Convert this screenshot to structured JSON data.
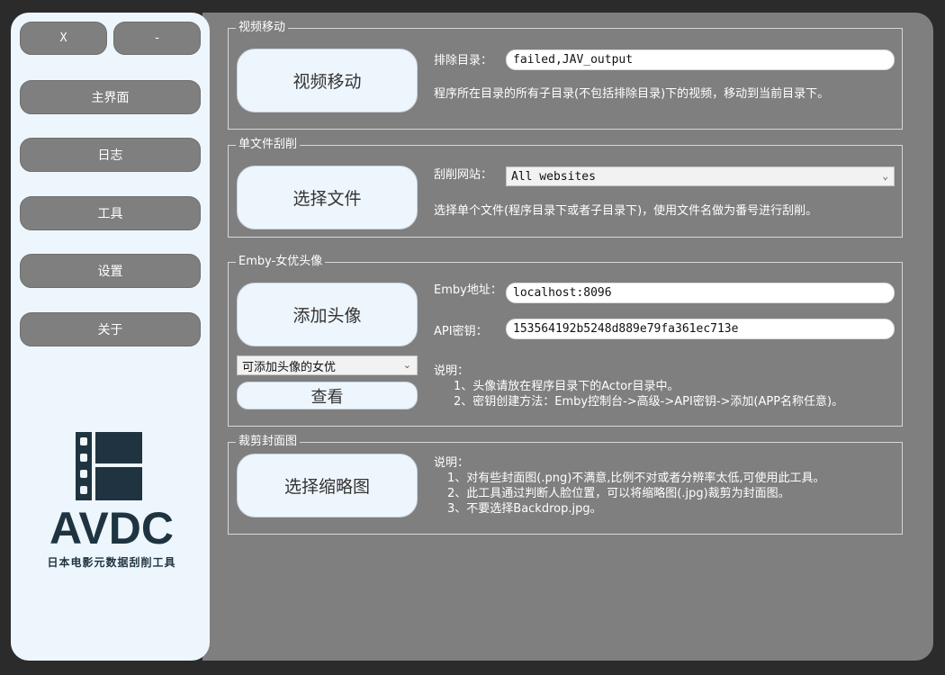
{
  "window": {
    "close_label": "X",
    "minimize_label": "-"
  },
  "sidebar": {
    "items": [
      {
        "label": "主界面"
      },
      {
        "label": "日志"
      },
      {
        "label": "工具"
      },
      {
        "label": "设置"
      },
      {
        "label": "关于"
      }
    ],
    "logo_text": "AVDC",
    "logo_subtitle": "日本电影元数据刮削工具"
  },
  "video_move": {
    "group_title": "视频移动",
    "button_label": "视频移动",
    "exclude_label": "排除目录：",
    "exclude_value": "failed,JAV_output",
    "description": "程序所在目录的所有子目录(不包括排除目录)下的视频，移动到当前目录下。"
  },
  "single_scrape": {
    "group_title": "单文件刮削",
    "button_label": "选择文件",
    "site_label": "刮削网站：",
    "site_selected": "All websites",
    "description": "选择单个文件(程序目录下或者子目录下)，使用文件名做为番号进行刮削。"
  },
  "emby_avatar": {
    "group_title": "Emby-女优头像",
    "add_button_label": "添加头像",
    "actress_select": "可添加头像的女优",
    "view_button_label": "查看",
    "address_label": "Emby地址：",
    "address_value": "localhost:8096",
    "api_label": "API密钥：",
    "api_value": "153564192b5248d889e79fa361ec713e",
    "notes": [
      "说明：",
      "1、头像请放在程序目录下的Actor目录中。",
      "2、密钥创建方法：Emby控制台->高级->API密钥->添加(APP名称任意)。"
    ]
  },
  "crop_cover": {
    "group_title": "裁剪封面图",
    "button_label": "选择缩略图",
    "notes": [
      "说明：",
      "1、对有些封面图(.png)不满意,比例不对或者分辨率太低,可使用此工具。",
      "2、此工具通过判断人脸位置，可以将缩略图(.jpg)裁剪为封面图。",
      "3、不要选择Backdrop.jpg。"
    ]
  },
  "colors": {
    "window_bg": "#2b2b2b",
    "panel_bg": "#7f7f7f",
    "sidebar_bg": "#eef6fd",
    "logo": "#1f3440"
  }
}
